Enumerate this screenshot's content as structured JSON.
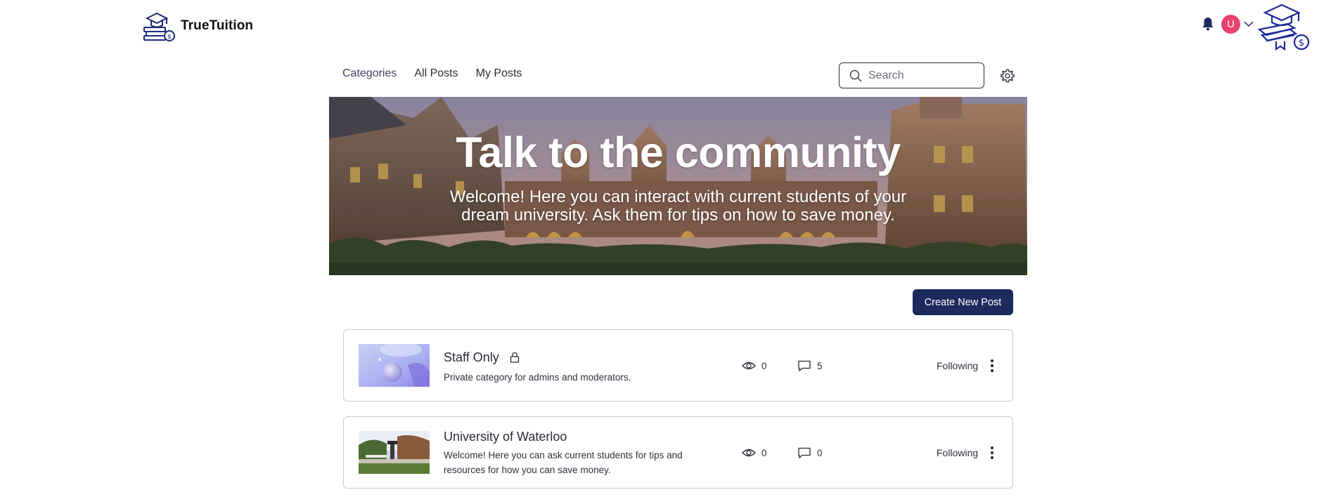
{
  "header": {
    "brand_name": "TrueTuition",
    "avatar_initial": "U",
    "avatar_color": "#e8426f",
    "icons": [
      "bell-icon",
      "chevron-down-icon",
      "brand-logo"
    ]
  },
  "forum_nav": {
    "tabs": [
      {
        "label": "Categories",
        "active": true
      },
      {
        "label": "All Posts",
        "active": false
      },
      {
        "label": "My Posts",
        "active": false
      }
    ],
    "search_placeholder": "Search",
    "settings_icon": "gear-icon"
  },
  "hero": {
    "title": "Talk to the community",
    "subtitle": "Welcome! Here you can interact with current students of your dream university. Ask them for tips on how to save money."
  },
  "actions": {
    "create_label": "Create New Post",
    "accent_color": "#1d2a5e"
  },
  "categories": [
    {
      "title": "Staff Only",
      "description": "Private category for admins and moderators.",
      "views": "0",
      "comments": "5",
      "follow_label": "Following",
      "locked": true
    },
    {
      "title": "University of Waterloo",
      "description": "Welcome! Here you can ask current students for tips and resources for how you can save money.",
      "views": "0",
      "comments": "0",
      "follow_label": "Following",
      "locked": false
    }
  ]
}
